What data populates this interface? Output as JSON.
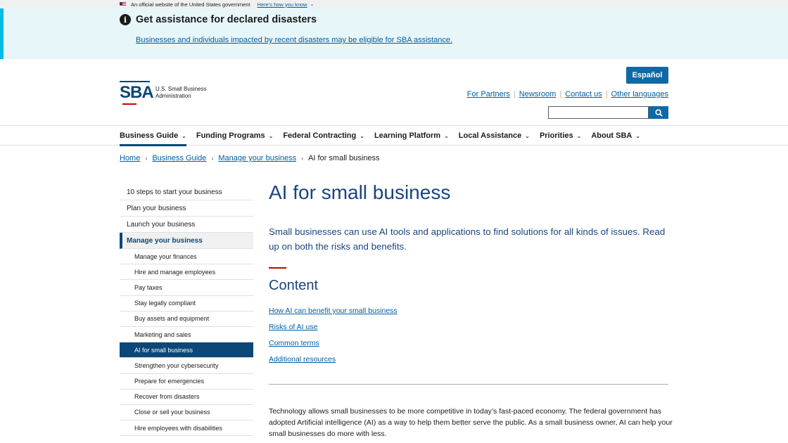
{
  "gov_banner": {
    "text": "An official website of the United States government",
    "link": "Here's how you know"
  },
  "alert": {
    "title": "Get assistance for declared disasters",
    "link": "Businesses and individuals impacted by recent disasters may be eligible for SBA assistance."
  },
  "header": {
    "logo_mark": "SBA",
    "logo_line1": "U.S. Small Business",
    "logo_line2": "Administration",
    "espanol": "Español",
    "util_links": [
      "For Partners",
      "Newsroom",
      "Contact us",
      "Other languages"
    ],
    "search_value": ""
  },
  "nav": {
    "items": [
      "Business Guide",
      "Funding Programs",
      "Federal Contracting",
      "Learning Platform",
      "Local Assistance",
      "Priorities",
      "About SBA"
    ],
    "active": "Business Guide"
  },
  "breadcrumb": {
    "items": [
      "Home",
      "Business Guide",
      "Manage your business"
    ],
    "current": "AI for small business"
  },
  "sidenav": {
    "top_items": [
      "10 steps to start your business",
      "Plan your business",
      "Launch your business"
    ],
    "current_parent": "Manage your business",
    "sub_items": [
      "Manage your finances",
      "Hire and manage employees",
      "Pay taxes",
      "Stay legally compliant",
      "Buy assets and equipment",
      "Marketing and sales",
      "AI for small business",
      "Strengthen your cybersecurity",
      "Prepare for emergencies",
      "Recover from disasters",
      "Close or sell your business",
      "Hire employees with disabilities"
    ],
    "active_sub": "AI for small business"
  },
  "main": {
    "title": "AI for small business",
    "intro": "Small businesses can use AI tools and applications to find solutions for all kinds of issues. Read up on both the risks and benefits.",
    "content_heading": "Content",
    "toc": [
      "How AI can benefit your small business",
      "Risks of AI use",
      "Common terms",
      "Additional resources"
    ],
    "body": "Technology allows small businesses to be more competitive in today’s fast-paced economy.  The federal government has adopted Artificial intelligence (AI) as a way to help them better serve the public. As a small business owner, AI can help your small businesses do more with less."
  },
  "colors": {
    "primary": "#0b4778",
    "link": "#005ea2",
    "button": "#0e6aa6",
    "alert_bg": "#e7f6f8",
    "alert_border": "#00bde3",
    "accent_red": "#cc0000"
  },
  "icons": [
    "us-flag-icon",
    "info-icon",
    "chevron-down-icon",
    "search-icon",
    "chevron-right-icon"
  ]
}
